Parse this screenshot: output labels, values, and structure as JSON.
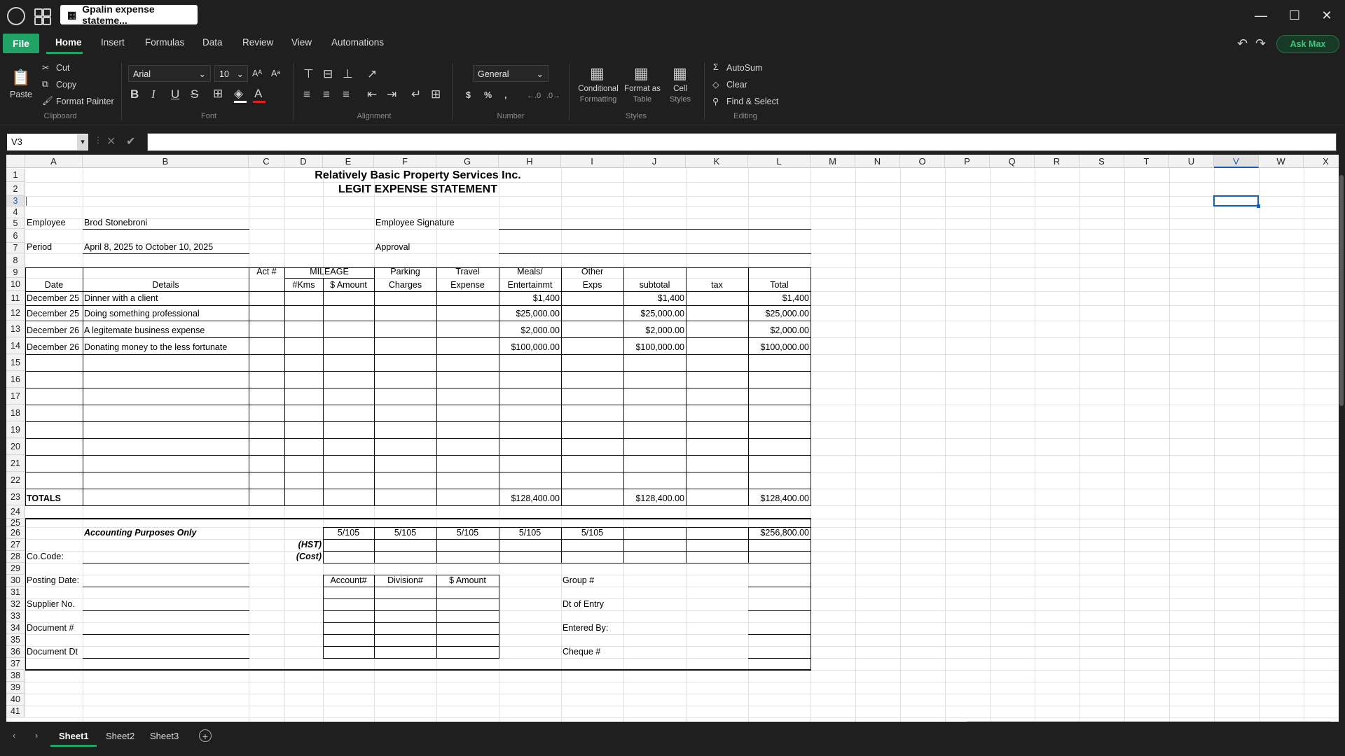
{
  "window": {
    "doc_title": "Gpalin expense stateme...",
    "minimize": "—",
    "maximize": "☐",
    "close": "✕"
  },
  "menu": {
    "file": "File",
    "items": [
      "Home",
      "Insert",
      "Formulas",
      "Data",
      "Review",
      "View",
      "Automations"
    ],
    "ask": "Ask Max"
  },
  "ribbon": {
    "paste": "Paste",
    "cut": "Cut",
    "copy": "Copy",
    "format_painter": "Format Painter",
    "clipboard": "Clipboard",
    "font_name": "Arial",
    "font_size": "10",
    "font": "Font",
    "alignment": "Alignment",
    "number_format": "General",
    "number": "Number",
    "conditional": "Conditional",
    "formatting": "Formatting",
    "format_as": "Format as",
    "table": "Table",
    "cell": "Cell",
    "styles_word": "Styles",
    "styles": "Styles",
    "autosum": "AutoSum",
    "clear": "Clear",
    "find_select": "Find & Select",
    "editing": "Editing"
  },
  "formula_bar": {
    "cell_ref": "V3",
    "formula": ""
  },
  "columns": [
    "A",
    "B",
    "C",
    "D",
    "E",
    "F",
    "G",
    "H",
    "I",
    "J",
    "K",
    "L",
    "M",
    "N",
    "O",
    "P",
    "Q",
    "R",
    "S",
    "T",
    "U",
    "V",
    "W",
    "X"
  ],
  "rows": [
    "1",
    "2",
    "3",
    "4",
    "5",
    "6",
    "7",
    "8",
    "9",
    "10",
    "11",
    "12",
    "13",
    "14",
    "15",
    "16",
    "17",
    "18",
    "19",
    "20",
    "21",
    "22",
    "23",
    "24",
    "25",
    "26",
    "27",
    "28",
    "29",
    "30",
    "31",
    "32",
    "33",
    "34",
    "35",
    "36",
    "37",
    "38",
    "39",
    "40",
    "41"
  ],
  "sheet": {
    "company": "Relatively Basic Property Services Inc.",
    "title": "LEGIT EXPENSE STATEMENT",
    "employee_label": "Employee",
    "employee_value": "Brod Stonebroni",
    "signature_label": "Employee Signature",
    "period_label": "Period",
    "period_value": "April 8, 2025 to October 10, 2025",
    "approval_label": "Approval",
    "headers": {
      "act": "Act #",
      "mileage": "MILEAGE",
      "kms": "#Kms",
      "amount": "$ Amount",
      "parking1": "Parking",
      "parking2": "Charges",
      "travel1": "Travel",
      "travel2": "Expense",
      "meals1": "Meals/",
      "meals2": "Entertainmt",
      "other1": "Other",
      "other2": "Exps",
      "date": "Date",
      "details": "Details",
      "subtotal": "subtotal",
      "tax": "tax",
      "total": "Total"
    },
    "entries": [
      {
        "date": "December 25",
        "details": "Dinner with a client",
        "meals": "$1,400",
        "subtotal": "$1,400",
        "total": "$1,400"
      },
      {
        "date": "December 25",
        "details": "Doing something professional",
        "meals": "$25,000.00",
        "subtotal": "$25,000.00",
        "total": "$25,000.00"
      },
      {
        "date": "December 26",
        "details": "A legitemate business expense",
        "meals": "$2,000.00",
        "subtotal": "$2,000.00",
        "total": "$2,000.00"
      },
      {
        "date": "December 26",
        "details": "Donating money to the less fortunate",
        "meals": "$100,000.00",
        "subtotal": "$100,000.00",
        "total": "$100,000.00"
      }
    ],
    "totals_label": "TOTALS",
    "totals_meals": "$128,400.00",
    "totals_subtotal": "$128,400.00",
    "totals_total": "$128,400.00",
    "accounting": "Accounting Purposes Only",
    "ratio": "5/105",
    "accounting_total": "$256,800.00",
    "hst": "(HST)",
    "cost": "(Cost)",
    "cocode": "Co.Code:",
    "posting": "Posting Date:",
    "supplier": "Supplier No.",
    "document": "Document #",
    "document_dt": "Document Dt",
    "account": "Account#",
    "division": "Division#",
    "samount": "$ Amount",
    "group": "Group #",
    "dt_entry": "Dt of Entry",
    "entered_by": "Entered By:",
    "cheque": "Cheque #"
  },
  "tabs": [
    "Sheet1",
    "Sheet2",
    "Sheet3"
  ]
}
